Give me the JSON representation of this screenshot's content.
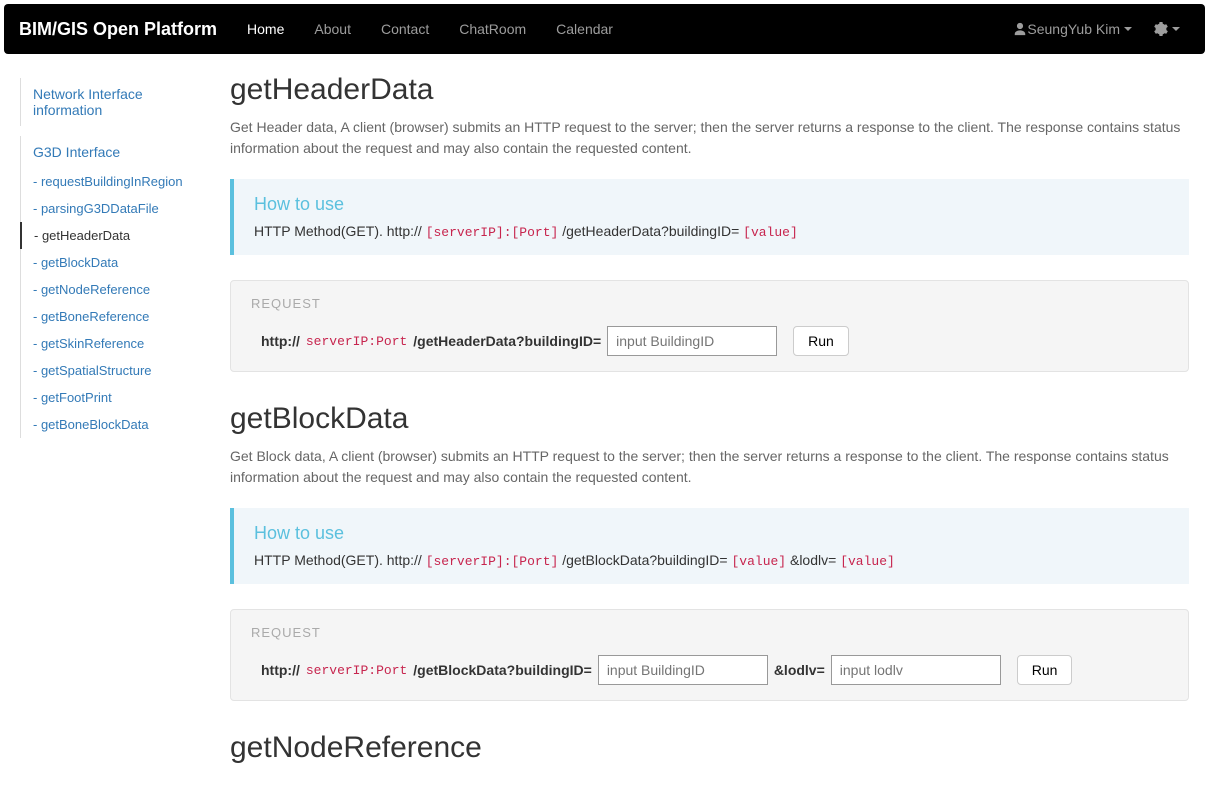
{
  "navbar": {
    "brand": "BIM/GIS Open Platform",
    "items": [
      "Home",
      "About",
      "Contact",
      "ChatRoom",
      "Calendar"
    ],
    "user": "SeungYub Kim"
  },
  "sidebar": {
    "top_link": "Network Interface information",
    "section_title": "G3D Interface",
    "items": [
      "- requestBuildingInRegion",
      "- parsingG3DDataFile",
      "- getHeaderData",
      "- getBlockData",
      "- getNodeReference",
      "- getBoneReference",
      "- getSkinReference",
      "- getSpatialStructure",
      "- getFootPrint",
      "- getBoneBlockData"
    ]
  },
  "sections": {
    "headerData": {
      "title": "getHeaderData",
      "desc": "Get Header data, A client (browser) submits an HTTP request to the server; then the server returns a response to the client. The response contains status information about the request and may also contain the requested content.",
      "howto_title": "How to use",
      "howto_prefix": "HTTP Method(GET). http:// ",
      "howto_mono1": "[serverIP]:[Port]",
      "howto_mid": " /getHeaderData?buildingID= ",
      "howto_mono2": "[value]",
      "req_label": "REQUEST",
      "req_prefix": "http:// ",
      "req_mono": "serverIP:Port",
      "req_path": " /getHeaderData?buildingID=",
      "placeholder": "input BuildingID",
      "run": "Run"
    },
    "blockData": {
      "title": "getBlockData",
      "desc": "Get Block data, A client (browser) submits an HTTP request to the server; then the server returns a response to the client. The response contains status information about the request and may also contain the requested content.",
      "howto_title": "How to use",
      "howto_prefix": "HTTP Method(GET). http:// ",
      "howto_mono1": "[serverIP]:[Port]",
      "howto_mid": " /getBlockData?buildingID= ",
      "howto_mono2": "[value]",
      "howto_mid2": " &lodlv= ",
      "howto_mono3": "[value]",
      "req_label": "REQUEST",
      "req_prefix": "http:// ",
      "req_mono": "serverIP:Port",
      "req_path": " /getBlockData?buildingID=",
      "placeholder1": "input BuildingID",
      "req_path2": "&lodlv=",
      "placeholder2": "input lodlv",
      "run": "Run"
    },
    "nodeRef": {
      "title": "getNodeReference"
    }
  }
}
